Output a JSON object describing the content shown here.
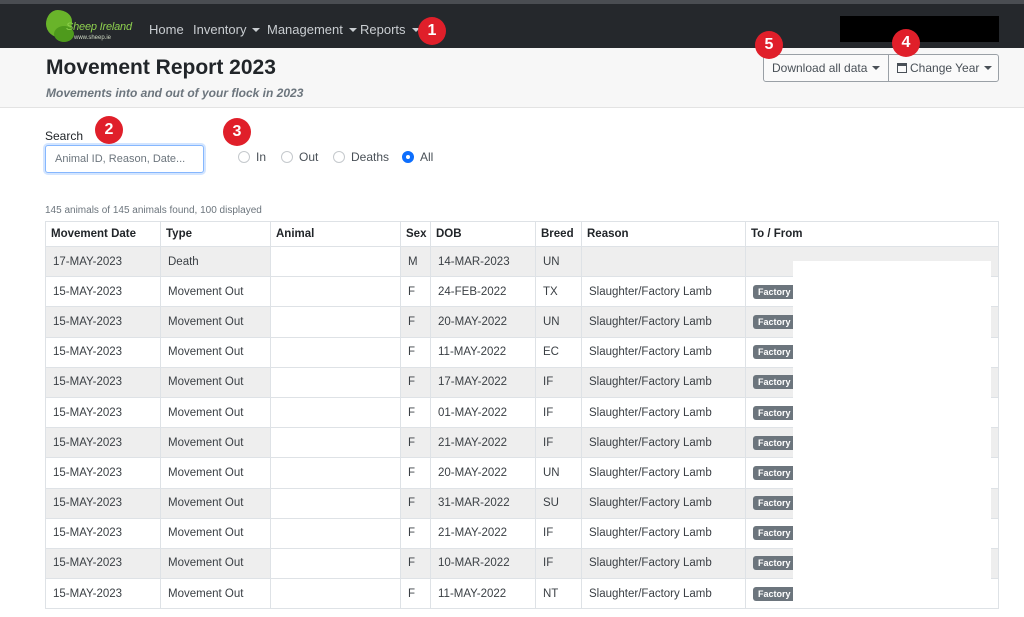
{
  "nav": {
    "brand": "Sheep Ireland",
    "brand_url": "www.sheep.ie",
    "items": [
      {
        "label": "Home",
        "has_caret": false
      },
      {
        "label": "Inventory",
        "has_caret": true
      },
      {
        "label": "Management",
        "has_caret": true
      },
      {
        "label": "Reports",
        "has_caret": true
      }
    ]
  },
  "badges": [
    "1",
    "2",
    "3",
    "4",
    "5"
  ],
  "header": {
    "title": "Movement Report 2023",
    "subtitle": "Movements into and out of your flock in 2023",
    "download_label": "Download all data",
    "change_year_label": "Change Year"
  },
  "search": {
    "label": "Search",
    "placeholder": "Animal ID, Reason, Date..."
  },
  "filters": [
    {
      "label": "In",
      "checked": false
    },
    {
      "label": "Out",
      "checked": false
    },
    {
      "label": "Deaths",
      "checked": false
    },
    {
      "label": "All",
      "checked": true
    }
  ],
  "summary": "145 animals of 145 animals found, 100 displayed",
  "table": {
    "columns": [
      "Movement Date",
      "Type",
      "Animal",
      "Sex",
      "DOB",
      "Breed",
      "Reason",
      "To / From"
    ],
    "rows": [
      {
        "date": "17-MAY-2023",
        "type": "Death",
        "animal": "",
        "sex": "M",
        "dob": "14-MAR-2023",
        "breed": "UN",
        "reason": "",
        "dest": ""
      },
      {
        "date": "15-MAY-2023",
        "type": "Movement Out",
        "animal": "",
        "sex": "F",
        "dob": "24-FEB-2022",
        "breed": "TX",
        "reason": "Slaughter/Factory Lamb",
        "dest": "Factory"
      },
      {
        "date": "15-MAY-2023",
        "type": "Movement Out",
        "animal": "",
        "sex": "F",
        "dob": "20-MAY-2022",
        "breed": "UN",
        "reason": "Slaughter/Factory Lamb",
        "dest": "Factory"
      },
      {
        "date": "15-MAY-2023",
        "type": "Movement Out",
        "animal": "",
        "sex": "F",
        "dob": "11-MAY-2022",
        "breed": "EC",
        "reason": "Slaughter/Factory Lamb",
        "dest": "Factory"
      },
      {
        "date": "15-MAY-2023",
        "type": "Movement Out",
        "animal": "",
        "sex": "F",
        "dob": "17-MAY-2022",
        "breed": "IF",
        "reason": "Slaughter/Factory Lamb",
        "dest": "Factory"
      },
      {
        "date": "15-MAY-2023",
        "type": "Movement Out",
        "animal": "",
        "sex": "F",
        "dob": "01-MAY-2022",
        "breed": "IF",
        "reason": "Slaughter/Factory Lamb",
        "dest": "Factory"
      },
      {
        "date": "15-MAY-2023",
        "type": "Movement Out",
        "animal": "",
        "sex": "F",
        "dob": "21-MAY-2022",
        "breed": "IF",
        "reason": "Slaughter/Factory Lamb",
        "dest": "Factory"
      },
      {
        "date": "15-MAY-2023",
        "type": "Movement Out",
        "animal": "",
        "sex": "F",
        "dob": "20-MAY-2022",
        "breed": "UN",
        "reason": "Slaughter/Factory Lamb",
        "dest": "Factory"
      },
      {
        "date": "15-MAY-2023",
        "type": "Movement Out",
        "animal": "",
        "sex": "F",
        "dob": "31-MAR-2022",
        "breed": "SU",
        "reason": "Slaughter/Factory Lamb",
        "dest": "Factory"
      },
      {
        "date": "15-MAY-2023",
        "type": "Movement Out",
        "animal": "",
        "sex": "F",
        "dob": "21-MAY-2022",
        "breed": "IF",
        "reason": "Slaughter/Factory Lamb",
        "dest": "Factory"
      },
      {
        "date": "15-MAY-2023",
        "type": "Movement Out",
        "animal": "",
        "sex": "F",
        "dob": "10-MAR-2022",
        "breed": "IF",
        "reason": "Slaughter/Factory Lamb",
        "dest": "Factory"
      },
      {
        "date": "15-MAY-2023",
        "type": "Movement Out",
        "animal": "",
        "sex": "F",
        "dob": "11-MAY-2022",
        "breed": "NT",
        "reason": "Slaughter/Factory Lamb",
        "dest": "Factory"
      }
    ]
  }
}
